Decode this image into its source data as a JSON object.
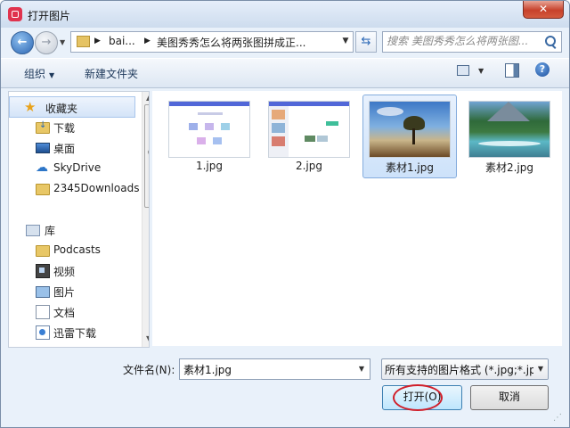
{
  "window": {
    "title": "打开图片",
    "close_label": "✕"
  },
  "address": {
    "segments": [
      "bai...",
      "美图秀秀怎么将两张图拼成正..."
    ],
    "search_placeholder": "搜索 美图秀秀怎么将两张图..."
  },
  "toolbar": {
    "organize": "组织",
    "new_folder": "新建文件夹",
    "help": "?"
  },
  "nav": {
    "favorites": {
      "label": "收藏夹",
      "items": [
        "下载",
        "桌面",
        "SkyDrive",
        "2345Downloads"
      ]
    },
    "libraries": {
      "label": "库",
      "items": [
        "Podcasts",
        "视频",
        "图片",
        "文档",
        "迅雷下载"
      ]
    }
  },
  "files": [
    {
      "name": "1.jpg",
      "selected": false
    },
    {
      "name": "2.jpg",
      "selected": false
    },
    {
      "name": "素材1.jpg",
      "selected": true
    },
    {
      "name": "素材2.jpg",
      "selected": false
    }
  ],
  "footer": {
    "filename_label": "文件名(N):",
    "filename_value": "素材1.jpg",
    "filetype_value": "所有支持的图片格式 (*.jpg;*.jp",
    "open_button": "打开(O)",
    "cancel_button": "取消"
  },
  "colors": {
    "annotation_ring": "#d01f2a",
    "selection": "#cde2fa"
  }
}
